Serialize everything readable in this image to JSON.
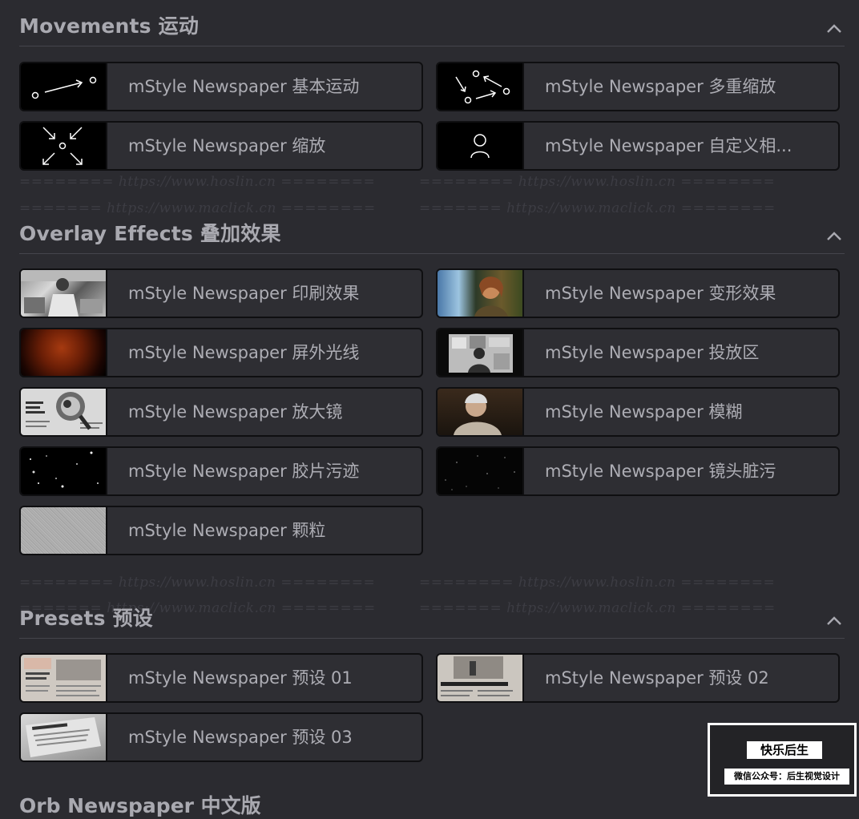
{
  "sections": {
    "movements": {
      "title": "Movements 运动",
      "items": [
        {
          "label": "mStyle Newspaper 基本运动",
          "icon": "arrow-path-icon"
        },
        {
          "label": "mStyle Newspaper 多重缩放",
          "icon": "multi-arrow-icon"
        },
        {
          "label": "mStyle Newspaper 缩放",
          "icon": "zoom-arrows-icon"
        },
        {
          "label": "mStyle Newspaper 自定义相...",
          "icon": "person-icon"
        }
      ]
    },
    "overlay": {
      "title": "Overlay Effects 叠加效果",
      "items": [
        {
          "label": "mStyle Newspaper 印刷效果"
        },
        {
          "label": "mStyle Newspaper 变形效果"
        },
        {
          "label": "mStyle Newspaper 屏外光线"
        },
        {
          "label": "mStyle Newspaper 投放区"
        },
        {
          "label": "mStyle Newspaper 放大镜"
        },
        {
          "label": "mStyle Newspaper 模糊"
        },
        {
          "label": "mStyle Newspaper 胶片污迹"
        },
        {
          "label": "mStyle Newspaper 镜头脏污"
        },
        {
          "label": "mStyle Newspaper 颗粒"
        }
      ]
    },
    "presets": {
      "title": "Presets 预设",
      "items": [
        {
          "label": "mStyle Newspaper 预设 01"
        },
        {
          "label": "mStyle Newspaper 预设 02"
        },
        {
          "label": "mStyle Newspaper 预设 03"
        }
      ]
    },
    "next": {
      "title": "Orb Newspaper 中文版"
    }
  },
  "watermarks": {
    "hoslin": "======== https://www.hoslin.cn ========",
    "maclick": "======= https://www.maclick.cn ========"
  },
  "badge": {
    "title": "快乐后生",
    "subtitle": "微信公众号：后生视觉设计"
  },
  "colors": {
    "background": "#2b2b30",
    "card": "#2e2e33",
    "card_border": "#0f0f11",
    "label": "#adadb4",
    "header": "#a9a9b0"
  }
}
